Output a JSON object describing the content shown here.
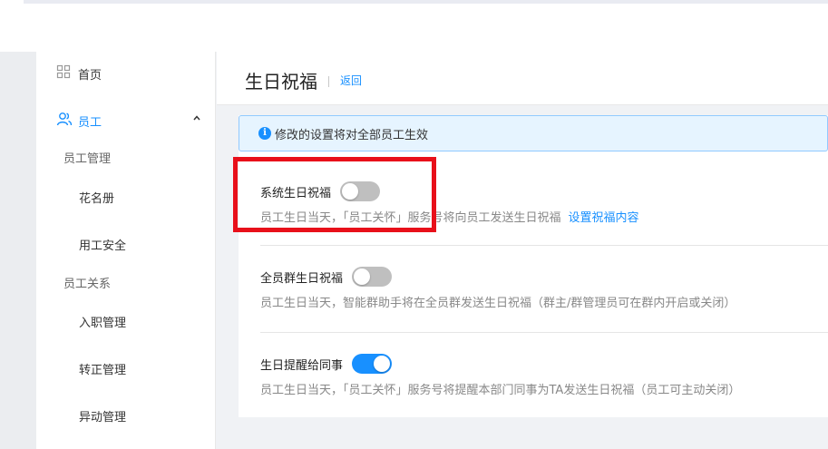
{
  "sidebar": {
    "home_label": "首页",
    "group_label": "员工",
    "sections": [
      {
        "title": "员工管理",
        "items": [
          "花名册",
          "用工安全"
        ]
      },
      {
        "title": "员工关系",
        "items": [
          "入职管理",
          "转正管理",
          "异动管理"
        ]
      }
    ]
  },
  "header": {
    "title": "生日祝福",
    "back_label": "返回"
  },
  "notice": {
    "text": "修改的设置将对全部员工生效"
  },
  "settings": [
    {
      "label": "系统生日祝福",
      "enabled": false,
      "description": "员工生日当天，「员工关怀」服务号将向员工发送生日祝福",
      "link_label": "设置祝福内容"
    },
    {
      "label": "全员群生日祝福",
      "enabled": false,
      "description": "员工生日当天，智能群助手将在全员群发送生日祝福（群主/群管理员可在群内开启或关闭）"
    },
    {
      "label": "生日提醒给同事",
      "enabled": true,
      "description": "员工生日当天，「员工关怀」服务号将提醒本部门同事为TA发送生日祝福（员工可主动关闭）"
    }
  ],
  "colors": {
    "accent": "#1890ff",
    "highlight_box": "#e8101a",
    "toggle_off": "#bfbfbf"
  }
}
